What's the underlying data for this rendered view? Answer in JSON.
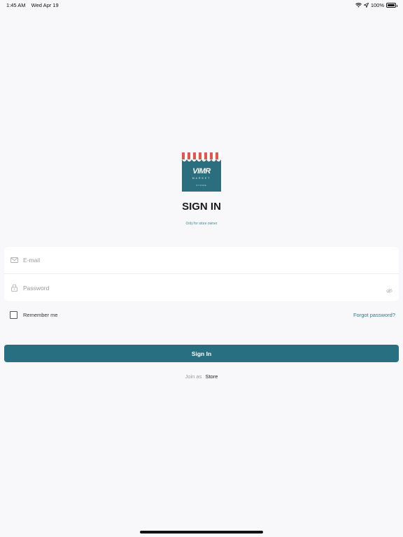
{
  "status_bar": {
    "time": "1:45 AM",
    "date": "Wed Apr 19",
    "battery_text": "100%",
    "battery_level": 1.0
  },
  "logo": {
    "text": "VIMR",
    "subtext": "MARKET",
    "tagline": "STORE"
  },
  "page": {
    "title": "SIGN IN",
    "subtitle": "Only for store owner"
  },
  "form": {
    "email_placeholder": "E-mail",
    "email_value": "",
    "password_placeholder": "Password",
    "password_value": "",
    "remember_label": "Remember me",
    "remember_checked": false,
    "forgot_label": "Forgot password?",
    "signin_label": "Sign In"
  },
  "join": {
    "prefix": "Join as",
    "link": "Store"
  },
  "colors": {
    "accent": "#276f81",
    "logo_bg": "#2b6f7f",
    "awning_red": "#e0584a",
    "background": "#f8f8fa"
  },
  "icons": [
    "wifi-icon",
    "location-arrow-icon",
    "battery-icon",
    "mail-icon",
    "lock-icon",
    "eye-icon"
  ]
}
